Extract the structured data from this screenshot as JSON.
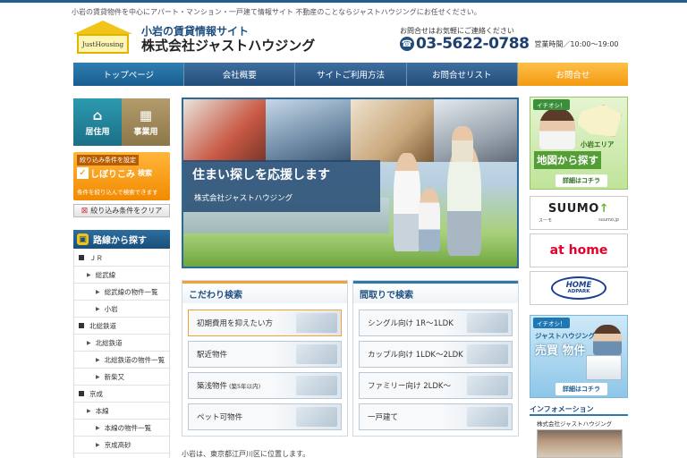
{
  "header": {
    "tagline": "小岩の賃貸物件を中心にアパート・マンション・一戸建て情報サイト 不動産のことならジャストハウジングにお任せください。",
    "logo_text": "JustHousing",
    "site_sub": "小岩の賃貸情報サイト",
    "site_name": "株式会社ジャストハウジング",
    "contact_note": "お問合せはお気軽にご連絡ください",
    "phone": "03-5622-0788",
    "hours": "営業時間／10:00～19:00"
  },
  "nav": {
    "items": [
      {
        "label": "トップページ"
      },
      {
        "label": "会社概要"
      },
      {
        "label": "サイトご利用方法"
      },
      {
        "label": "お問合せリスト"
      },
      {
        "label": "お問合せ"
      }
    ]
  },
  "sidebar": {
    "tabs": [
      {
        "label": "居住用",
        "icon": "house-icon"
      },
      {
        "label": "事業用",
        "icon": "building-icon"
      }
    ],
    "narrow": {
      "head": "絞り込み条件を設定",
      "title": "しぼりこみ",
      "title_suffix": "検索",
      "sub": "条件を絞り込んで検索できます"
    },
    "clear_label": "絞り込み条件をクリア",
    "route_title": "路線から探す",
    "route_items": [
      {
        "label": "ＪＲ"
      },
      {
        "label": "総武線"
      },
      {
        "label": "総武線の物件一覧"
      },
      {
        "label": "小岩"
      },
      {
        "label": "北総鉄道"
      },
      {
        "label": "北総鉄道"
      },
      {
        "label": "北総鉄道の物件一覧"
      },
      {
        "label": "新柴又"
      },
      {
        "label": "京成"
      },
      {
        "label": "本線"
      },
      {
        "label": "本線の物件一覧"
      },
      {
        "label": "京成高砂"
      }
    ]
  },
  "hero": {
    "catch": "住まい探しを応援します",
    "company": "株式会社ジャストハウジング"
  },
  "kodawari": {
    "title": "こだわり検索",
    "items": [
      {
        "label": "初期費用を抑えたい方",
        "note": ""
      },
      {
        "label": "駅近物件",
        "note": ""
      },
      {
        "label": "築浅物件",
        "note": "(築5年以内)"
      },
      {
        "label": "ペット可物件",
        "note": ""
      }
    ]
  },
  "madori": {
    "title": "間取りで検索",
    "items": [
      {
        "label": "シングル向け 1R～1LDK"
      },
      {
        "label": "カップル向け 1LDK～2LDK"
      },
      {
        "label": "ファミリー向け 2LDK～"
      },
      {
        "label": "一戸建て"
      }
    ]
  },
  "bottom_text": "小岩は、東京都江戸川区に位置します。",
  "right": {
    "map_banner": {
      "badge": "イチオシ！",
      "area": "小岩エリア",
      "big": "地図から探す",
      "more": "詳細はコチラ"
    },
    "suumo": {
      "name": "SUUMO",
      "sub_left": "スーモ",
      "sub_right": "suumo.jp"
    },
    "athome": {
      "name": "at home"
    },
    "homes": {
      "line1": "HOME",
      "line2": "ADPARK"
    },
    "sale_banner": {
      "badge": "イチオシ！",
      "line1": "ジャストハウジング",
      "line2": "売買 物件",
      "more": "詳細はコチラ"
    },
    "info_title": "インフォメーション",
    "info_company": "株式会社ジャストハウジング"
  },
  "colors": {
    "nav": "#234d7a",
    "accent_orange": "#f39a10",
    "brand_blue": "#1f4f80"
  }
}
